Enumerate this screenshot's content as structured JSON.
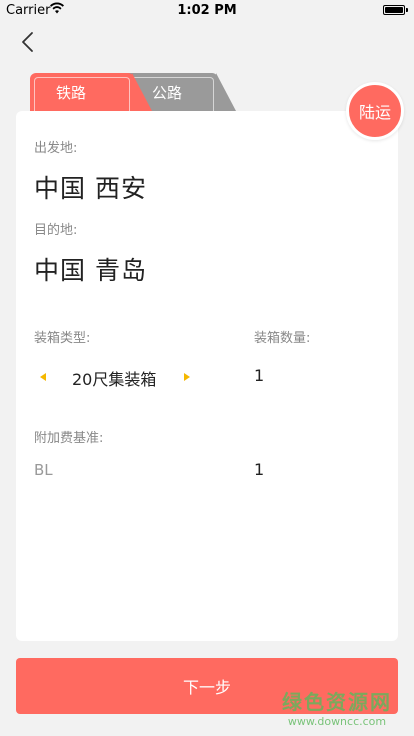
{
  "status": {
    "carrier": "Carrier",
    "time": "1:02 PM"
  },
  "tabs": {
    "rail": "铁路",
    "road": "公路"
  },
  "badge": "陆运",
  "origin": {
    "label": "出发地:",
    "value": "中国 西安"
  },
  "destination": {
    "label": "目的地:",
    "value": "中国 青岛"
  },
  "container_type": {
    "label": "装箱类型:",
    "value": "20尺集装箱"
  },
  "container_qty": {
    "label": "装箱数量:",
    "value": "1"
  },
  "surcharge": {
    "label": "附加费基准:",
    "unit": "BL",
    "value": "1"
  },
  "next_button": "下一步",
  "watermark": {
    "title": "绿色资源网",
    "url": "www.downcc.com"
  },
  "colors": {
    "accent": "#ff6a60",
    "inactive_tab": "#9a9a9a",
    "arrow": "#f5b800"
  }
}
